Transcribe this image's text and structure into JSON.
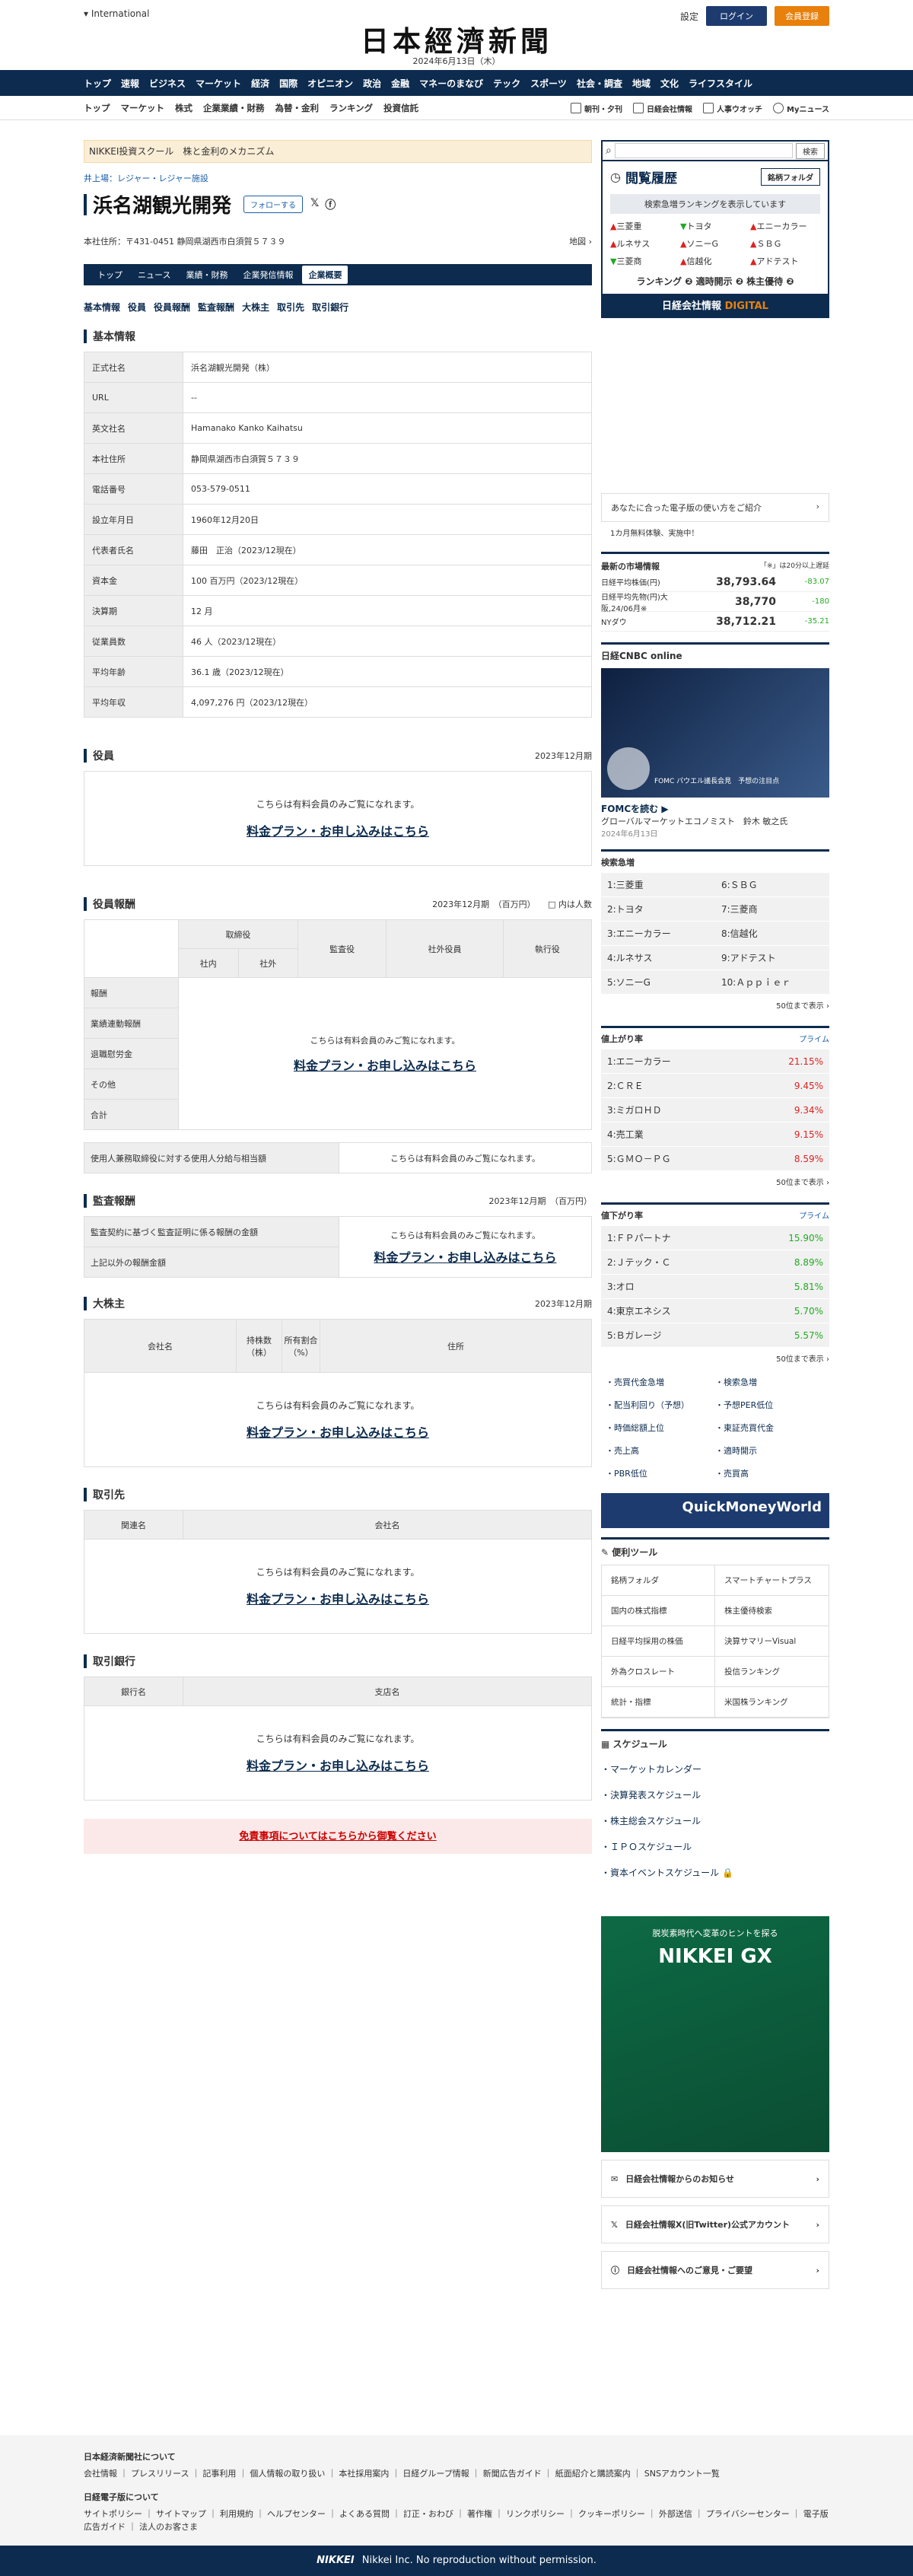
{
  "header": {
    "international": "International",
    "logo": "日本經濟新聞",
    "date": "2024年6月13日（木）",
    "settings": "設定",
    "login": "ログイン",
    "register": "会員登録"
  },
  "gnav": [
    "トップ",
    "速報",
    "ビジネス",
    "マーケット",
    "経済",
    "国際",
    "オピニオン",
    "政治",
    "金融",
    "マネーのまなび",
    "テック",
    "スポーツ",
    "社会・調査",
    "地域",
    "文化",
    "ライフスタイル"
  ],
  "snav": [
    "トップ",
    "マーケット",
    "株式",
    "企業業績・財務",
    "為替・金利",
    "ランキング",
    "投資信託"
  ],
  "snav_right": [
    "朝刊・夕刊",
    "日経会社情報",
    "人事ウオッチ",
    "Myニュース"
  ],
  "promo": "NIKKEI投資スクール　株と金利のメカニズム",
  "breadcrumb": "井上場：レジャー・レジャー施設",
  "company": {
    "name": "浜名湖観光開発",
    "follow": "フォローする",
    "address": "本社住所：〒431-0451 静岡県湖西市白須賀５７３９",
    "map": "地図"
  },
  "tabs": [
    "トップ",
    "ニュース",
    "業績・財務",
    "企業発信情報",
    "企業概要"
  ],
  "sublinks": [
    "基本情報",
    "役員",
    "役員報酬",
    "監査報酬",
    "大株主",
    "取引先",
    "取引銀行"
  ],
  "basic": {
    "title": "基本情報",
    "rows": [
      [
        "正式社名",
        "浜名湖観光開発（株）"
      ],
      [
        "URL",
        "--"
      ],
      [
        "英文社名",
        "Hamanako Kanko Kaihatsu"
      ],
      [
        "本社住所",
        "静岡県湖西市白須賀５７３９"
      ],
      [
        "電話番号",
        "053-579-0511"
      ],
      [
        "設立年月日",
        "1960年12月20日"
      ],
      [
        "代表者氏名",
        "藤田　正治（2023/12現在）"
      ],
      [
        "資本金",
        "100 百万円（2023/12現在）"
      ],
      [
        "決算期",
        "12 月"
      ],
      [
        "従業員数",
        "46 人（2023/12現在）"
      ],
      [
        "平均年齢",
        "36.1 歳（2023/12現在）"
      ],
      [
        "平均年収",
        "4,097,276 円（2023/12現在）"
      ]
    ]
  },
  "member_msg": "こちらは有料会員のみご覧になれます。",
  "plan_link": "料金プラン・お申し込みはこちら",
  "officers": {
    "title": "役員",
    "period": "2023年12月期"
  },
  "comp": {
    "title": "役員報酬",
    "period": "2023年12月期　（百万円）",
    "unit": "内は人数",
    "h_director": "取締役",
    "h_in": "社内",
    "h_out": "社外",
    "h_auditor": "監査役",
    "h_ext": "社外役員",
    "h_exec": "執行役",
    "rows": [
      "報酬",
      "業績連動報酬",
      "退職慰労金",
      "その他",
      "合計"
    ],
    "note": "使用人兼務取締役に対する使用人分給与相当額"
  },
  "audit": {
    "title": "監査報酬",
    "period": "2023年12月期　（百万円）",
    "rows": [
      "監査契約に基づく監査証明に係る報酬の金額",
      "上記以外の報酬金額"
    ]
  },
  "holders": {
    "title": "大株主",
    "period": "2023年12月期",
    "cols": [
      "会社名",
      "持株数（株）",
      "所有割合（%）",
      "住所"
    ]
  },
  "partners": {
    "title": "取引先",
    "cols": [
      "関連名",
      "会社名"
    ]
  },
  "banks": {
    "title": "取引銀行",
    "cols": [
      "銀行名",
      "支店名"
    ]
  },
  "disclaimer": "免責事項についてはこちらから御覧ください",
  "side": {
    "search_btn": "検索",
    "history": "閲覧履歴",
    "folder": "銘柄フォルダ",
    "rank_btn": "検索急増ランキングを表示しています",
    "stocks": [
      [
        "三菱重",
        "up"
      ],
      [
        "トヨタ",
        "dn"
      ],
      [
        "エニーカラー",
        "up"
      ],
      [
        "ルネサス",
        "up"
      ],
      [
        "ソニーG",
        "up"
      ],
      [
        "ＳＢＧ",
        "up"
      ],
      [
        "三菱商",
        "dn"
      ],
      [
        "信越化",
        "up"
      ],
      [
        "アドテスト",
        "up"
      ]
    ],
    "links": "ランキング ❷ 適時開示 ❷ 株主優待 ❷",
    "digital1": "日経会社情報",
    "digital2": "DIGITAL",
    "paper": "あなたに合った電子版の使い方をご紹介",
    "paper_sub": "1カ月無料体験、実施中！",
    "market_head": "最新の市場情報",
    "market_note": "「※」は20分以上遅延",
    "market": [
      [
        "日経平均株価(円)",
        "38,793.64",
        "-83.07"
      ],
      [
        "日経平均先物(円)大阪,24/06月※",
        "38,770",
        "-180"
      ],
      [
        "NYダウ",
        "38,712.21",
        "-35.21"
      ]
    ],
    "cnbc": "日経CNBC online",
    "video_cap": "FOMC パウエル議長会見　予想の注目点",
    "fomc_title": "FOMCを読む",
    "fomc_sub": "グローバルマーケットエコノミスト　鈴木 敏之氏",
    "fomc_date": "2024年6月13日",
    "search_rank_title": "検索急増",
    "search_rank": [
      "1:三菱重",
      "6:ＳＢＧ",
      "2:トヨタ",
      "7:三菱商",
      "3:エニーカラー",
      "8:信越化",
      "4:ルネサス",
      "9:アドテスト",
      "5:ソニーG",
      "10:Ａｐｐｉｅｒ"
    ],
    "more": "50位まで表示",
    "gain_title": "値上がり率",
    "prime": "プライム",
    "gains": [
      [
        "1:エニーカラー",
        "21.15%"
      ],
      [
        "2:ＣＲＥ",
        "9.45%"
      ],
      [
        "3:ミガロＨＤ",
        "9.34%"
      ],
      [
        "4:売工業",
        "9.15%"
      ],
      [
        "5:ＧＭＯ－ＰＧ",
        "8.59%"
      ]
    ],
    "loss_title": "値下がり率",
    "losses": [
      [
        "1:ＦＰパートナ",
        "15.90%"
      ],
      [
        "2:Ｊテック・Ｃ",
        "8.89%"
      ],
      [
        "3:オロ",
        "5.81%"
      ],
      [
        "4:東京エネシス",
        "5.70%"
      ],
      [
        "5:Ｂガレージ",
        "5.57%"
      ]
    ],
    "linkgrid": [
      "・売買代金急増",
      "・検索急増",
      "・配当利回り（予想）",
      "・予想PER低位",
      "・時価総額上位",
      "・東証売買代金",
      "・売上高",
      "・適時開示",
      "・PBR低位",
      "・売買高"
    ],
    "qmw": "QuickMoneyWorld",
    "tools_title": "便利ツール",
    "tools": [
      "銘柄フォルダ",
      "スマートチャートプラス",
      "国内の株式指標",
      "株主優待検索",
      "日経平均採用の株価",
      "決算サマリーVisual",
      "外為クロスレート",
      "投信ランキング",
      "統計・指標",
      "米国株ランキング"
    ],
    "sched_title": "スケジュール",
    "sched": [
      "・マーケットカレンダー",
      "・決算発表スケジュール",
      "・株主総会スケジュール",
      "・ＩＰＯスケジュール",
      "・資本イベントスケジュール"
    ],
    "gx_top": "脱炭素時代へ変革のヒントを探る",
    "gx_big": "NIKKEI GX",
    "sb_links": [
      "日経会社情報からのお知らせ",
      "日経会社情報X(旧Twitter)公式アカウント",
      "日経会社情報へのご意見・ご要望"
    ]
  },
  "footer": {
    "h1": "日本経済新聞社について",
    "l1": "会社情報 ｜ プレスリリース ｜ 記事利用 ｜ 個人情報の取り扱い ｜ 本社採用案内 ｜ 日経グループ情報 ｜ 新聞広告ガイド ｜ 紙面紹介と購読案内 ｜ SNSアカウント一覧",
    "h2": "日経電子版について",
    "l2": "サイトポリシー ｜ サイトマップ ｜ 利用規約 ｜ ヘルプセンター ｜ よくある質問 ｜ 訂正・おわび ｜ 著作権 ｜ リンクポリシー ｜ クッキーポリシー ｜ 外部送信 ｜ プライバシーセンター ｜ 電子版広告ガイド ｜ 法人のお客さま",
    "brand": "NIKKEI",
    "copy": "Nikkei Inc. No reproduction without permission."
  }
}
